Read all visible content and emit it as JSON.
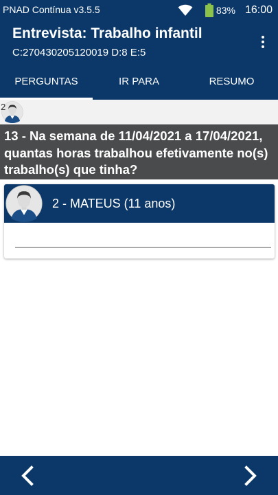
{
  "status_bar": {
    "app_name": "PNAD Contínua v3.5.5",
    "battery_percent": "83%",
    "battery_level": 0.83,
    "time": "16:00",
    "icons": [
      "wifi-icon",
      "battery-icon"
    ]
  },
  "header": {
    "title": "Entrevista: Trabalho infantil",
    "subtitle": "C:270430205120019 D:8 E:5",
    "menu_icon": "overflow-menu-icon"
  },
  "tabs": [
    {
      "label": "PERGUNTAS",
      "active": true
    },
    {
      "label": "IR PARA",
      "active": false
    },
    {
      "label": "RESUMO",
      "active": false
    }
  ],
  "person_strip": {
    "number": "2",
    "avatar_icon": "person-avatar-icon"
  },
  "question": {
    "text": "13 - Na semana de 11/04/2021 a 17/04/2021, quantas horas trabalhou efetivamente no(s) trabalho(s) que tinha?"
  },
  "answer_card": {
    "person_label": "2 - MATEUS (11 anos)",
    "avatar_icon": "person-avatar-icon",
    "input_value": "",
    "input_placeholder": ""
  },
  "footer": {
    "prev_icon": "chevron-left-icon",
    "next_icon": "chevron-right-icon"
  },
  "colors": {
    "primary": "#0b3868",
    "question_bg": "#4a4b4d",
    "strip_bg": "#f2f2f2",
    "battery_fill": "#8bc34a"
  }
}
